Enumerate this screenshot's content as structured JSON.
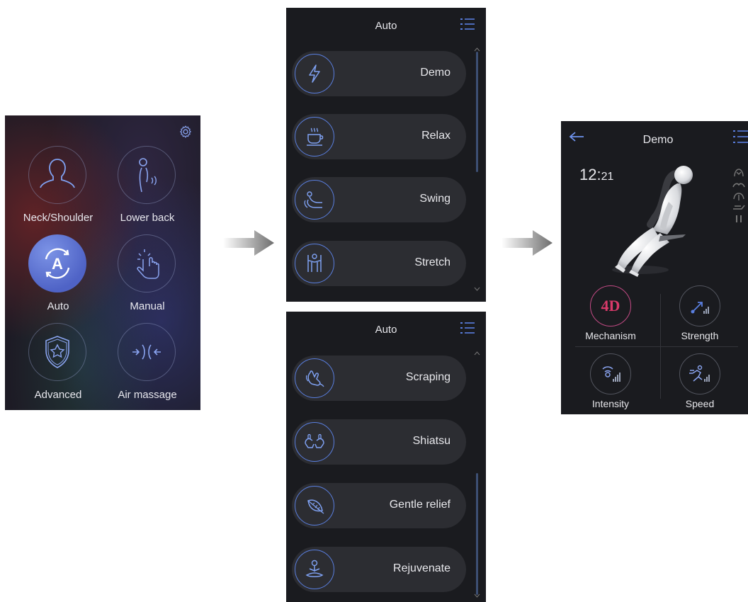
{
  "home": {
    "tiles": [
      {
        "label": "Neck/Shoulder",
        "icon": "neck-shoulder-icon"
      },
      {
        "label": "Lower back",
        "icon": "lower-back-icon"
      },
      {
        "label": "Auto",
        "icon": "auto-icon",
        "active": true
      },
      {
        "label": "Manual",
        "icon": "manual-icon"
      },
      {
        "label": "Advanced",
        "icon": "advanced-icon"
      },
      {
        "label": "Air massage",
        "icon": "air-massage-icon"
      }
    ],
    "settings_icon": "gear-icon"
  },
  "list_a": {
    "title": "Auto",
    "items": [
      {
        "label": "Demo",
        "icon": "lightning-icon"
      },
      {
        "label": "Relax",
        "icon": "coffee-cup-icon"
      },
      {
        "label": "Swing",
        "icon": "swing-icon"
      },
      {
        "label": "Stretch",
        "icon": "stretch-icon"
      }
    ]
  },
  "list_b": {
    "title": "Auto",
    "items": [
      {
        "label": "Scraping",
        "icon": "scraping-icon"
      },
      {
        "label": "Shiatsu",
        "icon": "shiatsu-icon"
      },
      {
        "label": "Gentle relief",
        "icon": "feather-icon"
      },
      {
        "label": "Rejuvenate",
        "icon": "meditation-icon"
      }
    ]
  },
  "demo": {
    "title": "Demo",
    "clock_hours": "12",
    "clock_sep": ":",
    "clock_minutes": "21",
    "controls": [
      {
        "label": "Mechanism",
        "badge": "4D",
        "active": true
      },
      {
        "label": "Strength"
      },
      {
        "label": "Intensity"
      },
      {
        "label": "Speed"
      }
    ]
  },
  "colors": {
    "accent_blue": "#5a7fe0",
    "accent_pink": "#d93a6a",
    "panel": "#1a1b1f",
    "pill": "#2c2d32"
  }
}
